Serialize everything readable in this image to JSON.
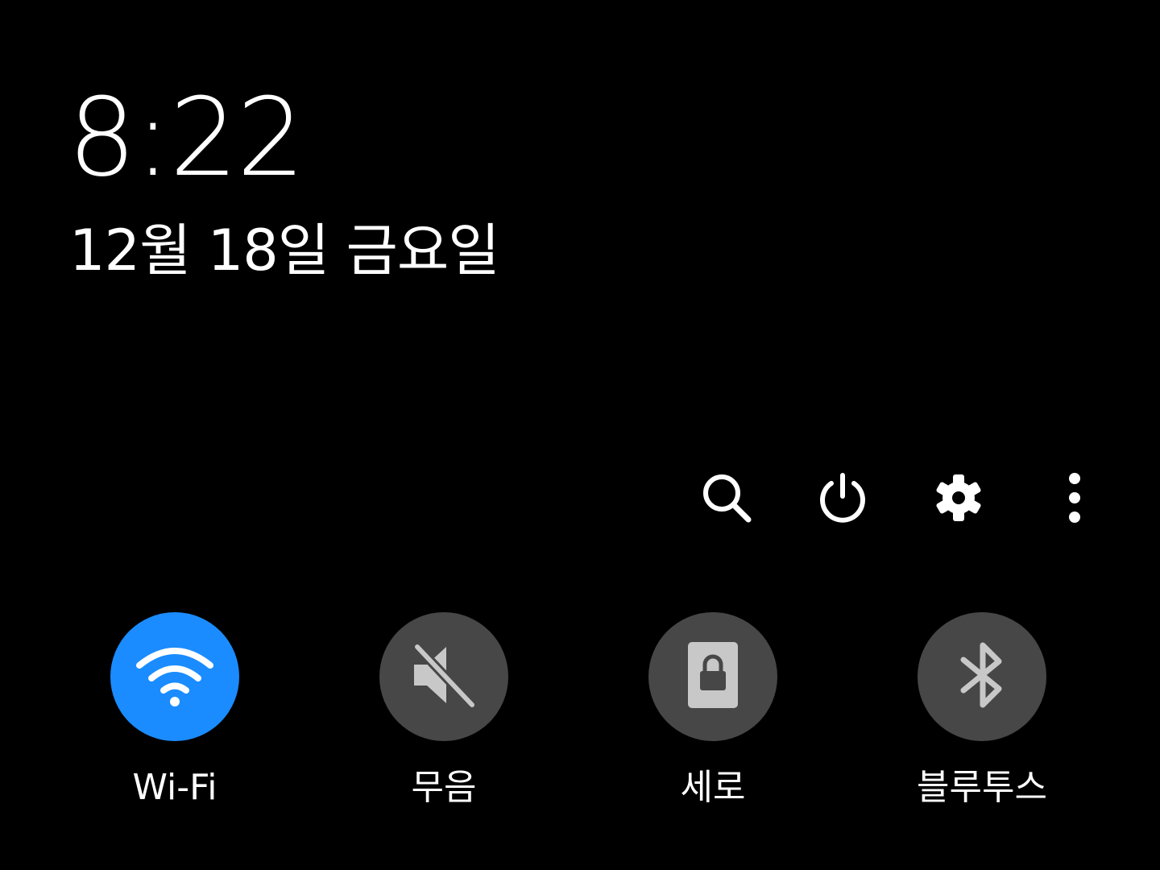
{
  "clock": {
    "time": "8:22",
    "date": "12월 18일 금요일"
  },
  "actions": [
    {
      "icon": "search-icon"
    },
    {
      "icon": "power-icon"
    },
    {
      "icon": "gear-icon"
    },
    {
      "icon": "more-vertical-icon"
    }
  ],
  "tiles": [
    {
      "label": "Wi-Fi",
      "icon": "wifi-icon",
      "active": true
    },
    {
      "label": "무음",
      "icon": "mute-icon",
      "active": false
    },
    {
      "label": "세로",
      "icon": "portrait-lock-icon",
      "active": false
    },
    {
      "label": "블루투스",
      "icon": "bluetooth-icon",
      "active": false
    }
  ],
  "colors": {
    "background": "#000000",
    "active_tile": "#1a8cff",
    "inactive_tile": "#474747",
    "inactive_icon": "#c8c8c8",
    "text": "#ffffff"
  }
}
